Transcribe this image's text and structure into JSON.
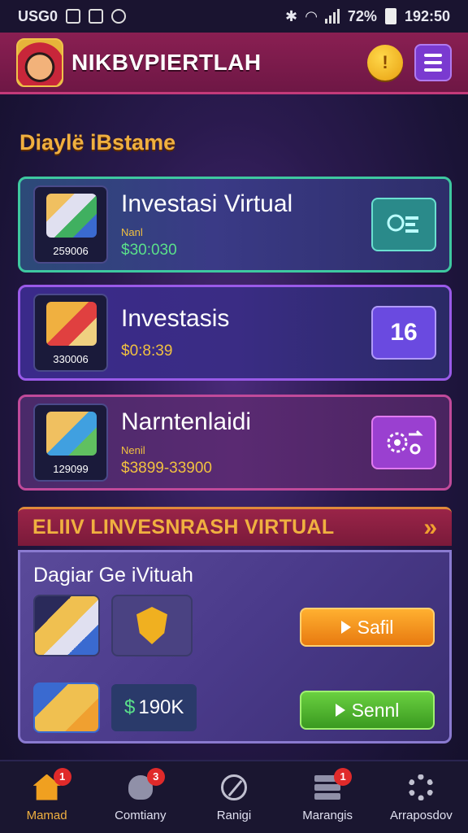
{
  "status_bar": {
    "carrier": "USG0",
    "battery": "72%",
    "time": "192:50"
  },
  "header": {
    "brand": "NIKBVPIERTLAH",
    "coin_label": "!"
  },
  "section_title": "Diaylë iBstame",
  "cards": [
    {
      "title": "Investasi Virtual",
      "thumb_value": "259006",
      "sub": "Nanl",
      "price": "$30:030",
      "action": "icon"
    },
    {
      "title": "Investasis",
      "thumb_value": "330006",
      "sub": "",
      "price": "$0:8:39",
      "action": "16"
    },
    {
      "title": "Narntenlaidi",
      "thumb_value": "129099",
      "sub": "Nenil",
      "price": "$3899-33900",
      "action": "icon"
    }
  ],
  "elite": {
    "banner_title": "ELIIV LINVESNRASH VIRTUAL",
    "arrow": "»",
    "subtitle": "Dagiar Ge iVituah",
    "chip_value": "$ 190K",
    "money_sign": "$",
    "amount": "190K",
    "orange_button": "Safil",
    "green_button": "Sennl"
  },
  "bottom_nav": [
    {
      "label": "Mamad",
      "badge": "1",
      "icon": "home-icon"
    },
    {
      "label": "Comtiany",
      "badge": "3",
      "icon": "rocket-icon"
    },
    {
      "label": "Ranigi",
      "badge": "",
      "icon": "compass-icon"
    },
    {
      "label": "Marangis",
      "badge": "1",
      "icon": "server-icon"
    },
    {
      "label": "Arraposdov",
      "badge": "",
      "icon": "gear-icon"
    }
  ],
  "colors": {
    "accent_gold": "#f0b040",
    "header_magenta": "#8a1f52",
    "price_green": "#5ae08a",
    "button_orange": "#e87a10",
    "button_green": "#3a9a20"
  }
}
